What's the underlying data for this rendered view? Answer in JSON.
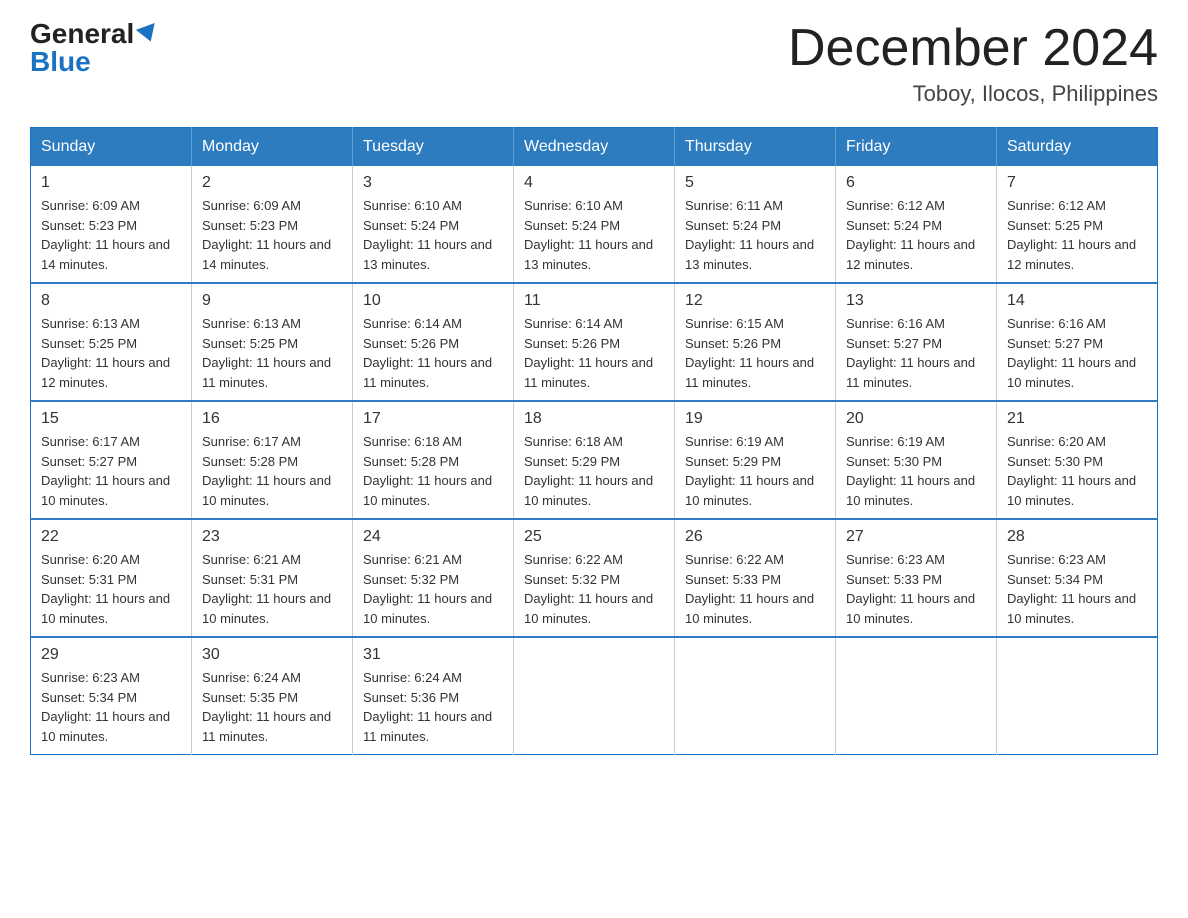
{
  "logo": {
    "general": "General",
    "blue": "Blue"
  },
  "header": {
    "month_title": "December 2024",
    "location": "Toboy, Ilocos, Philippines"
  },
  "weekdays": [
    "Sunday",
    "Monday",
    "Tuesday",
    "Wednesday",
    "Thursday",
    "Friday",
    "Saturday"
  ],
  "weeks": [
    [
      {
        "day": "1",
        "sunrise": "Sunrise: 6:09 AM",
        "sunset": "Sunset: 5:23 PM",
        "daylight": "Daylight: 11 hours and 14 minutes."
      },
      {
        "day": "2",
        "sunrise": "Sunrise: 6:09 AM",
        "sunset": "Sunset: 5:23 PM",
        "daylight": "Daylight: 11 hours and 14 minutes."
      },
      {
        "day": "3",
        "sunrise": "Sunrise: 6:10 AM",
        "sunset": "Sunset: 5:24 PM",
        "daylight": "Daylight: 11 hours and 13 minutes."
      },
      {
        "day": "4",
        "sunrise": "Sunrise: 6:10 AM",
        "sunset": "Sunset: 5:24 PM",
        "daylight": "Daylight: 11 hours and 13 minutes."
      },
      {
        "day": "5",
        "sunrise": "Sunrise: 6:11 AM",
        "sunset": "Sunset: 5:24 PM",
        "daylight": "Daylight: 11 hours and 13 minutes."
      },
      {
        "day": "6",
        "sunrise": "Sunrise: 6:12 AM",
        "sunset": "Sunset: 5:24 PM",
        "daylight": "Daylight: 11 hours and 12 minutes."
      },
      {
        "day": "7",
        "sunrise": "Sunrise: 6:12 AM",
        "sunset": "Sunset: 5:25 PM",
        "daylight": "Daylight: 11 hours and 12 minutes."
      }
    ],
    [
      {
        "day": "8",
        "sunrise": "Sunrise: 6:13 AM",
        "sunset": "Sunset: 5:25 PM",
        "daylight": "Daylight: 11 hours and 12 minutes."
      },
      {
        "day": "9",
        "sunrise": "Sunrise: 6:13 AM",
        "sunset": "Sunset: 5:25 PM",
        "daylight": "Daylight: 11 hours and 11 minutes."
      },
      {
        "day": "10",
        "sunrise": "Sunrise: 6:14 AM",
        "sunset": "Sunset: 5:26 PM",
        "daylight": "Daylight: 11 hours and 11 minutes."
      },
      {
        "day": "11",
        "sunrise": "Sunrise: 6:14 AM",
        "sunset": "Sunset: 5:26 PM",
        "daylight": "Daylight: 11 hours and 11 minutes."
      },
      {
        "day": "12",
        "sunrise": "Sunrise: 6:15 AM",
        "sunset": "Sunset: 5:26 PM",
        "daylight": "Daylight: 11 hours and 11 minutes."
      },
      {
        "day": "13",
        "sunrise": "Sunrise: 6:16 AM",
        "sunset": "Sunset: 5:27 PM",
        "daylight": "Daylight: 11 hours and 11 minutes."
      },
      {
        "day": "14",
        "sunrise": "Sunrise: 6:16 AM",
        "sunset": "Sunset: 5:27 PM",
        "daylight": "Daylight: 11 hours and 10 minutes."
      }
    ],
    [
      {
        "day": "15",
        "sunrise": "Sunrise: 6:17 AM",
        "sunset": "Sunset: 5:27 PM",
        "daylight": "Daylight: 11 hours and 10 minutes."
      },
      {
        "day": "16",
        "sunrise": "Sunrise: 6:17 AM",
        "sunset": "Sunset: 5:28 PM",
        "daylight": "Daylight: 11 hours and 10 minutes."
      },
      {
        "day": "17",
        "sunrise": "Sunrise: 6:18 AM",
        "sunset": "Sunset: 5:28 PM",
        "daylight": "Daylight: 11 hours and 10 minutes."
      },
      {
        "day": "18",
        "sunrise": "Sunrise: 6:18 AM",
        "sunset": "Sunset: 5:29 PM",
        "daylight": "Daylight: 11 hours and 10 minutes."
      },
      {
        "day": "19",
        "sunrise": "Sunrise: 6:19 AM",
        "sunset": "Sunset: 5:29 PM",
        "daylight": "Daylight: 11 hours and 10 minutes."
      },
      {
        "day": "20",
        "sunrise": "Sunrise: 6:19 AM",
        "sunset": "Sunset: 5:30 PM",
        "daylight": "Daylight: 11 hours and 10 minutes."
      },
      {
        "day": "21",
        "sunrise": "Sunrise: 6:20 AM",
        "sunset": "Sunset: 5:30 PM",
        "daylight": "Daylight: 11 hours and 10 minutes."
      }
    ],
    [
      {
        "day": "22",
        "sunrise": "Sunrise: 6:20 AM",
        "sunset": "Sunset: 5:31 PM",
        "daylight": "Daylight: 11 hours and 10 minutes."
      },
      {
        "day": "23",
        "sunrise": "Sunrise: 6:21 AM",
        "sunset": "Sunset: 5:31 PM",
        "daylight": "Daylight: 11 hours and 10 minutes."
      },
      {
        "day": "24",
        "sunrise": "Sunrise: 6:21 AM",
        "sunset": "Sunset: 5:32 PM",
        "daylight": "Daylight: 11 hours and 10 minutes."
      },
      {
        "day": "25",
        "sunrise": "Sunrise: 6:22 AM",
        "sunset": "Sunset: 5:32 PM",
        "daylight": "Daylight: 11 hours and 10 minutes."
      },
      {
        "day": "26",
        "sunrise": "Sunrise: 6:22 AM",
        "sunset": "Sunset: 5:33 PM",
        "daylight": "Daylight: 11 hours and 10 minutes."
      },
      {
        "day": "27",
        "sunrise": "Sunrise: 6:23 AM",
        "sunset": "Sunset: 5:33 PM",
        "daylight": "Daylight: 11 hours and 10 minutes."
      },
      {
        "day": "28",
        "sunrise": "Sunrise: 6:23 AM",
        "sunset": "Sunset: 5:34 PM",
        "daylight": "Daylight: 11 hours and 10 minutes."
      }
    ],
    [
      {
        "day": "29",
        "sunrise": "Sunrise: 6:23 AM",
        "sunset": "Sunset: 5:34 PM",
        "daylight": "Daylight: 11 hours and 10 minutes."
      },
      {
        "day": "30",
        "sunrise": "Sunrise: 6:24 AM",
        "sunset": "Sunset: 5:35 PM",
        "daylight": "Daylight: 11 hours and 11 minutes."
      },
      {
        "day": "31",
        "sunrise": "Sunrise: 6:24 AM",
        "sunset": "Sunset: 5:36 PM",
        "daylight": "Daylight: 11 hours and 11 minutes."
      },
      null,
      null,
      null,
      null
    ]
  ]
}
